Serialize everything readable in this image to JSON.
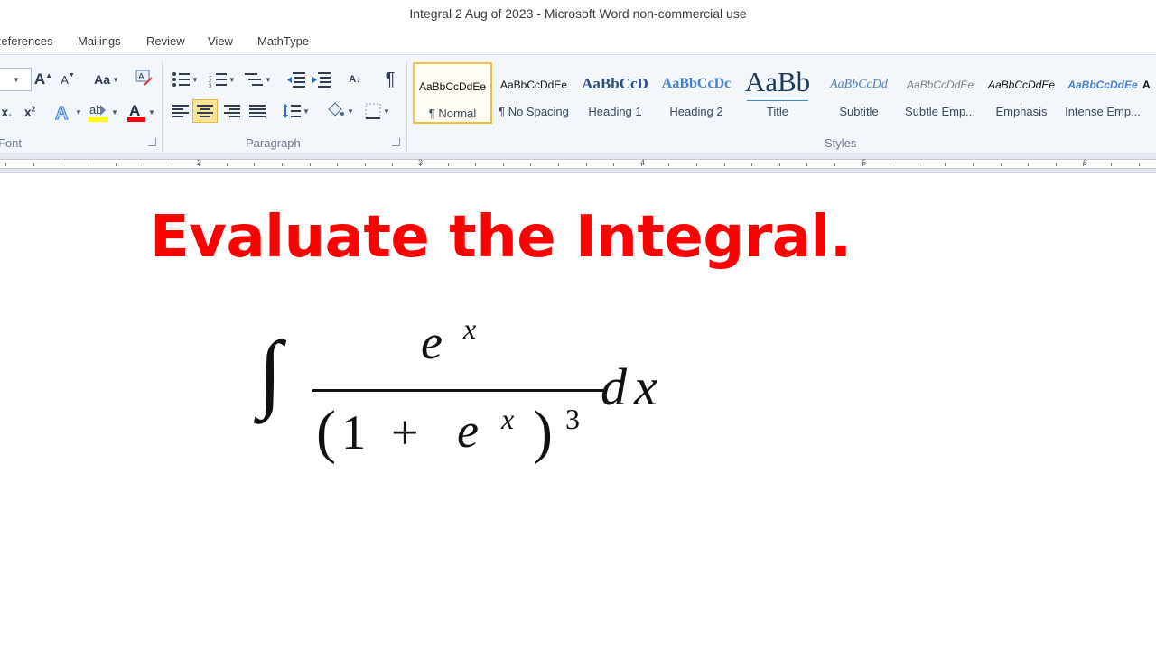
{
  "window": {
    "title": "Integral 2 Aug of 2023  -  Microsoft Word non-commercial use"
  },
  "tabs": [
    "References",
    "Mailings",
    "Review",
    "View",
    "MathType"
  ],
  "ribbon": {
    "groups": {
      "font": "Font",
      "paragraph": "Paragraph",
      "styles": "Styles"
    },
    "font_buttons": {
      "grow": "A",
      "shrink": "A",
      "change_case": "Aa",
      "clear": "A",
      "highlight": "ab",
      "font_color": "A"
    },
    "paragraph_buttons": {
      "show_marks": "¶",
      "sort": "A↓"
    },
    "styles": [
      {
        "sample": "AaBbCcDdEe",
        "name": "¶ Normal",
        "selected": true
      },
      {
        "sample": "AaBbCcDdEe",
        "name": "¶ No Spacing",
        "selected": false
      },
      {
        "sample": "AaBbCcD",
        "name": "Heading 1",
        "selected": false
      },
      {
        "sample": "AaBbCcDc",
        "name": "Heading 2",
        "selected": false
      },
      {
        "sample": "AaBb",
        "name": "Title",
        "selected": false
      },
      {
        "sample": "AaBbCcDd",
        "name": "Subtitle",
        "selected": false
      },
      {
        "sample": "AaBbCcDdEe",
        "name": "Subtle Emp...",
        "selected": false
      },
      {
        "sample": "AaBbCcDdEe",
        "name": "Emphasis",
        "selected": false
      },
      {
        "sample": "AaBbCcDdEe",
        "name": "Intense Emp...",
        "selected": false
      },
      {
        "sample": "A",
        "name": "",
        "selected": false
      }
    ]
  },
  "ruler": {
    "numbers": [
      "2",
      "3",
      "4",
      "5",
      "6"
    ]
  },
  "document": {
    "heading": "Evaluate the Integral.",
    "heading_color": "#ff0000",
    "equation": {
      "integral": "∫",
      "num_base": "e",
      "num_exp": "x",
      "den_open": "(",
      "den_one": "1",
      "den_plus": "+",
      "den_base": "e",
      "den_exp": "x",
      "den_close": ")",
      "den_power": "3",
      "differential": "dx"
    }
  },
  "colors": {
    "accent_selected": "#f0c14b",
    "ribbon_bg": "#f3f6fa"
  }
}
